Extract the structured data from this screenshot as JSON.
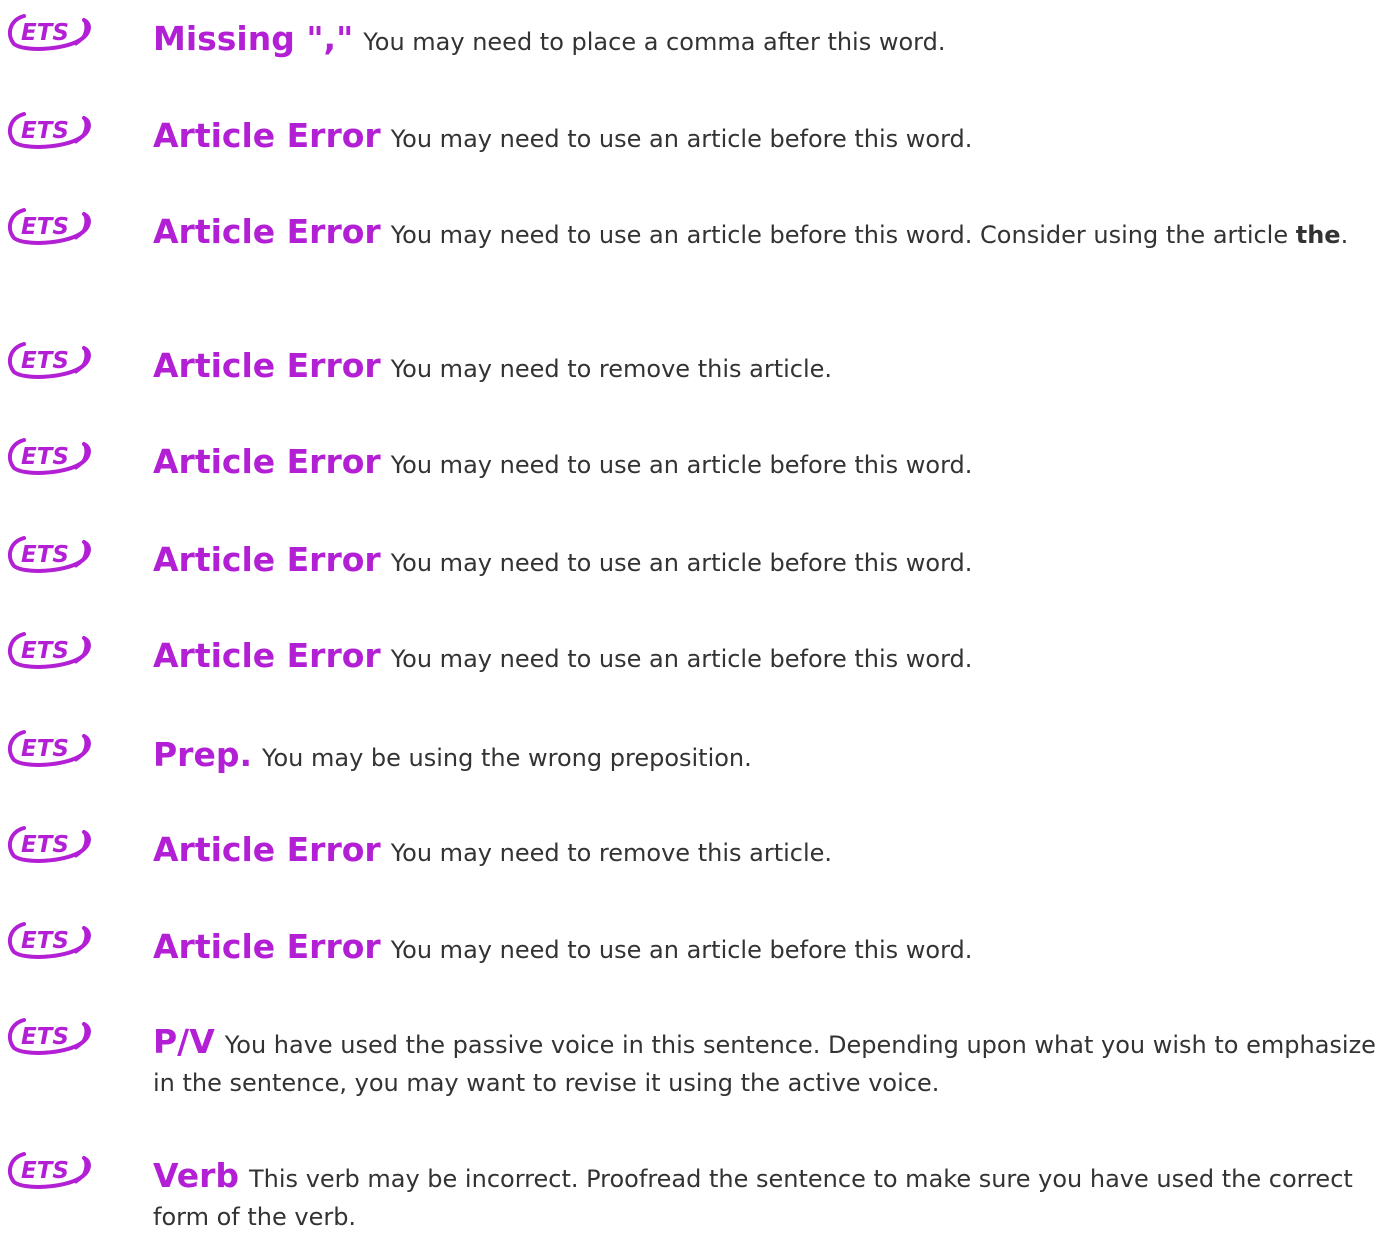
{
  "brand": {
    "logo_text": "ETS",
    "accent_color": "#b21fd4",
    "text_color": "#333333"
  },
  "items": [
    {
      "title": "Missing \",\"",
      "text": "You may need to place a comma after this word.",
      "emphasis": "",
      "trail": ""
    },
    {
      "title": "Article Error",
      "text": "You may need to use an article before this word.",
      "emphasis": "",
      "trail": ""
    },
    {
      "title": "Article Error",
      "text": "You may need to use an article before this word. Consider using the article ",
      "emphasis": "the",
      "trail": "."
    },
    {
      "title": "Article Error",
      "text": "You may need to remove this article.",
      "emphasis": "",
      "trail": ""
    },
    {
      "title": "Article Error",
      "text": "You may need to use an article before this word.",
      "emphasis": "",
      "trail": ""
    },
    {
      "title": "Article Error",
      "text": "You may need to use an article before this word.",
      "emphasis": "",
      "trail": ""
    },
    {
      "title": "Article Error",
      "text": "You may need to use an article before this word.",
      "emphasis": "",
      "trail": ""
    },
    {
      "title": "Prep.",
      "text": "You may be using the wrong preposition.",
      "emphasis": "",
      "trail": ""
    },
    {
      "title": "Article Error",
      "text": "You may need to remove this article.",
      "emphasis": "",
      "trail": ""
    },
    {
      "title": "Article Error",
      "text": "You may need to use an article before this word.",
      "emphasis": "",
      "trail": ""
    },
    {
      "title": "P/V",
      "text": "You have used the passive voice in this sentence. Depending upon what you wish to emphasize in the sentence, you may want to revise it using the active voice.",
      "emphasis": "",
      "trail": ""
    },
    {
      "title": "Verb",
      "text": "This verb may be incorrect. Proofread the sentence to make sure you have used the correct form of the verb.",
      "emphasis": "",
      "trail": ""
    }
  ]
}
